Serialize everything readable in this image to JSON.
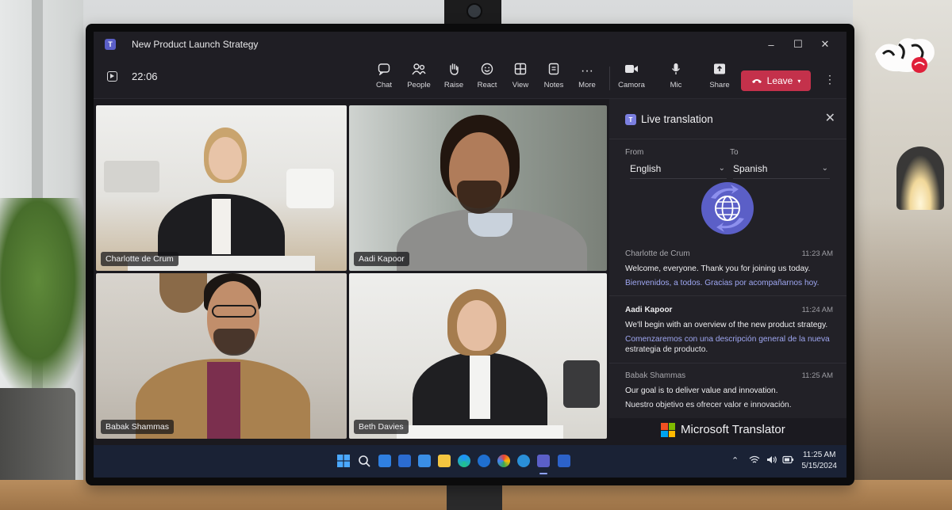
{
  "window": {
    "title": "New Product Launch Strategy",
    "controls": [
      "–",
      "☐",
      "✕"
    ]
  },
  "toolbar": {
    "timer": "22:06",
    "buttons": [
      {
        "id": "chat",
        "label": "Chat",
        "icon": "chat-icon"
      },
      {
        "id": "people",
        "label": "People",
        "icon": "people-icon"
      },
      {
        "id": "raise",
        "label": "Raise",
        "icon": "hand-icon"
      },
      {
        "id": "react",
        "label": "React",
        "icon": "smile-icon"
      },
      {
        "id": "view",
        "label": "View",
        "icon": "grid-icon"
      },
      {
        "id": "notes",
        "label": "Notes",
        "icon": "notes-icon"
      },
      {
        "id": "more",
        "label": "More",
        "icon": "more-icon"
      },
      {
        "id": "camera",
        "label": "Camora",
        "icon": "camera-icon"
      },
      {
        "id": "mic",
        "label": "Mic",
        "icon": "mic-icon"
      },
      {
        "id": "share",
        "label": "Share",
        "icon": "share-icon"
      }
    ],
    "leave_label": "Leave"
  },
  "participants": [
    {
      "name": "Charlotte de Crum"
    },
    {
      "name": "Aadi Kapoor"
    },
    {
      "name": "Babak Shammas"
    },
    {
      "name": "Beth Davies"
    }
  ],
  "translation": {
    "title": "Live translation",
    "from_label": "From",
    "to_label": "To",
    "from_lang": "English",
    "to_lang": "Spanish",
    "messages": [
      {
        "sender": "Charlotte de Crum",
        "time": "11:23 AM",
        "original": "Welcome, everyone. Thank you for joining us today.",
        "translated": "Bienvenidos, a todos. Gracias por acompañarnos hoy."
      },
      {
        "sender": "Aadi Kapoor",
        "time": "11:24 AM",
        "original": "We'll begin with an overview of the new product strategy.",
        "translated_a": "Comenzaremos con una",
        "translated_b": "descripción general de la nueva",
        "translated_c": "estrategia de producto."
      },
      {
        "sender": "Babak Shammas",
        "time": "11:25 AM",
        "original": "Our goal is to deliver value and innovation.",
        "translated": "Nuestro objetivo es ofrecer valor e innovación."
      }
    ],
    "footer": "Microsoft Translator"
  },
  "taskbar": {
    "time": "11:25 AM",
    "date": "5/15/2024",
    "colors": {
      "accent": "#5b5fc7",
      "leave": "#c4314b"
    }
  }
}
